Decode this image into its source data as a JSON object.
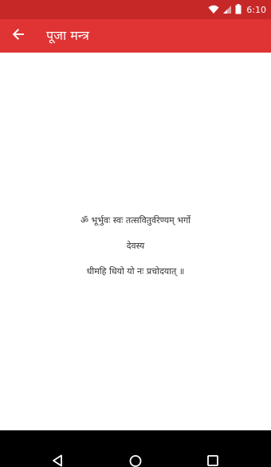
{
  "status_bar": {
    "time": "6:10",
    "icons": [
      "wifi-icon",
      "signal-icon",
      "battery-icon"
    ]
  },
  "app_bar": {
    "title": "पूजा मन्त्र",
    "back_icon": "arrow-back-icon"
  },
  "mantra": {
    "lines": [
      "ॐ भूर्भुवः स्वः तत्सवितुर्वरेण्यम् भर्गो",
      "देवस्य",
      "धीमहि धियो यो नः प्रचोदयात् ॥"
    ]
  },
  "nav_bar": {
    "icons": [
      "back-triangle-icon",
      "home-circle-icon",
      "recents-square-icon"
    ]
  },
  "colors": {
    "status_bar": "#c62828",
    "app_bar": "#e03434",
    "text": "#333333"
  }
}
